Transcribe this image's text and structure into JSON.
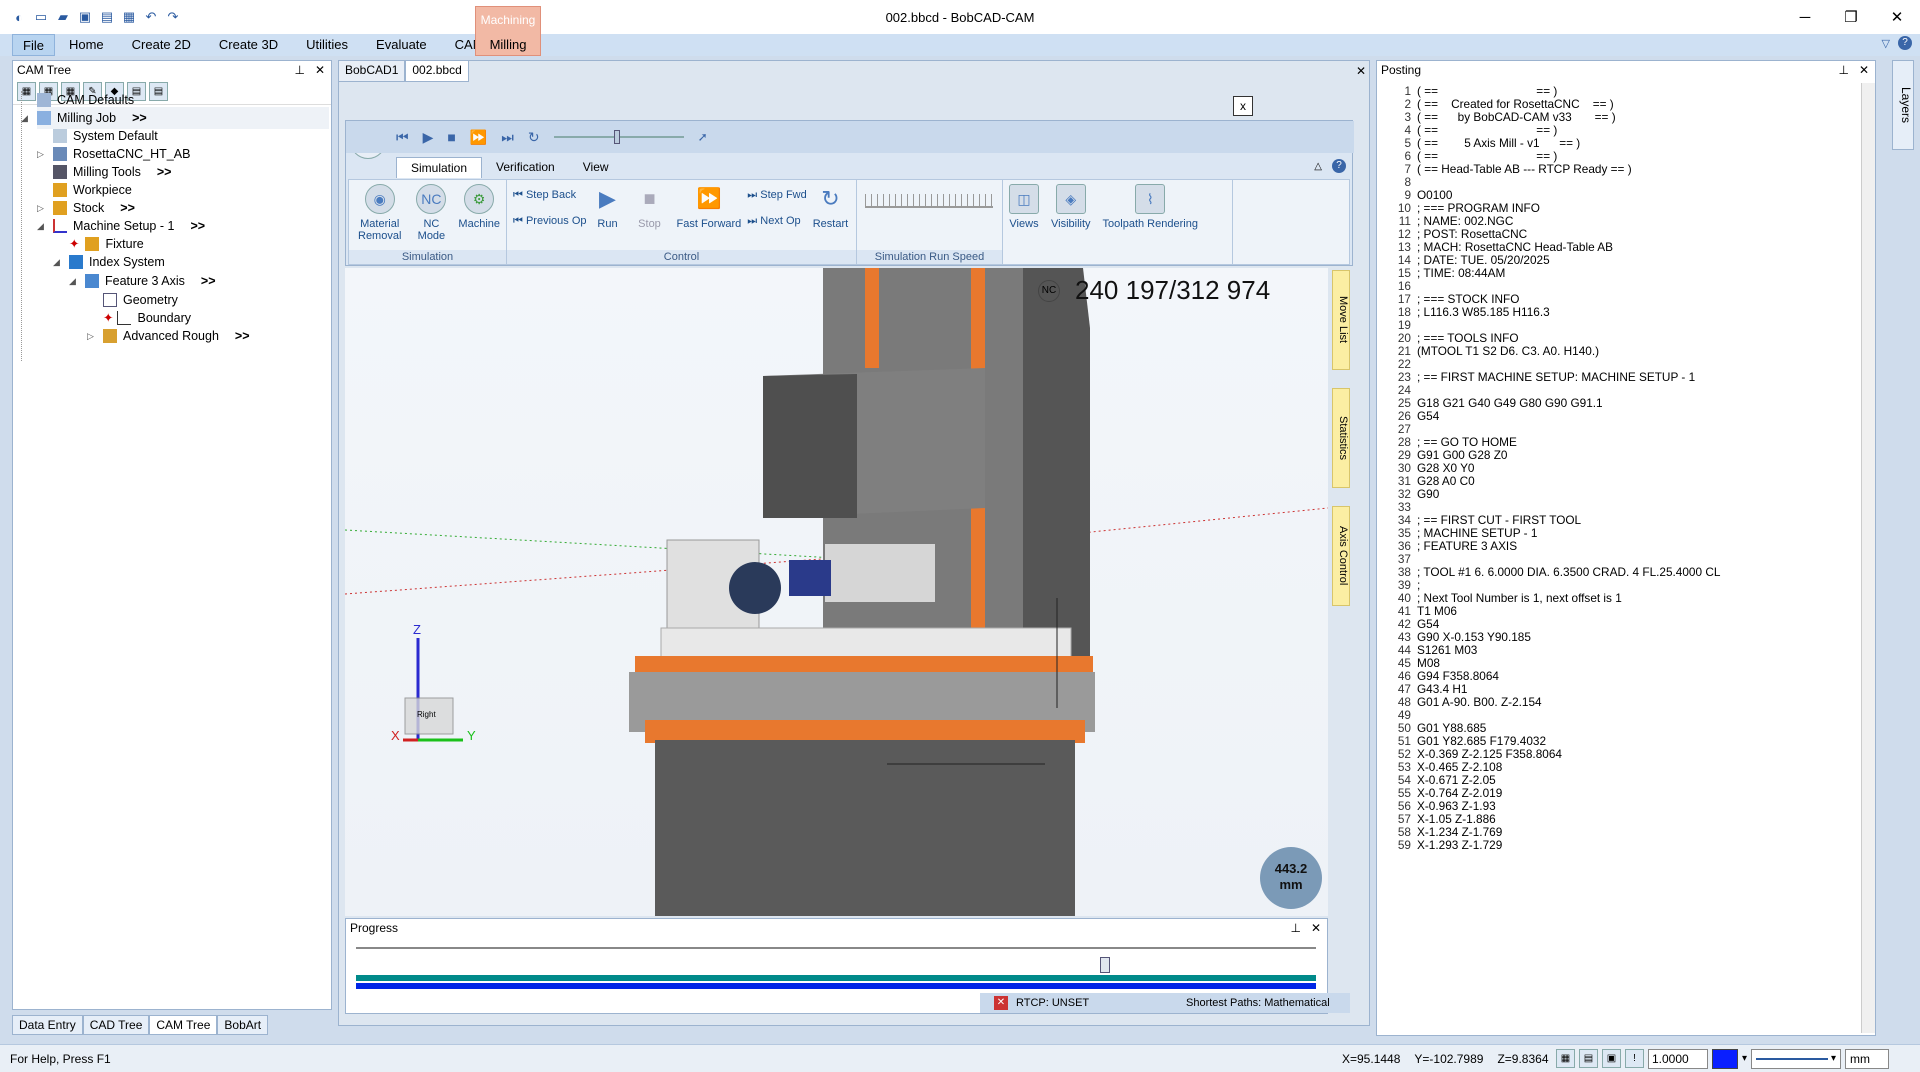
{
  "app": {
    "title": "002.bbcd - BobCAD-CAM"
  },
  "menu": {
    "file": "File",
    "items": [
      "Home",
      "Create 2D",
      "Create 3D",
      "Utilities",
      "Evaluate",
      "CAM"
    ],
    "context_group": "Machining",
    "context_tab": "Milling"
  },
  "cam_tree": {
    "title": "CAM Tree",
    "items": [
      {
        "label": "CAM Defaults",
        "arrow": ""
      },
      {
        "label": "Milling Job",
        "arrow": ">>"
      },
      {
        "label": "System Default",
        "arrow": ""
      },
      {
        "label": "RosettaCNC_HT_AB",
        "arrow": ""
      },
      {
        "label": "Milling Tools",
        "arrow": ">>"
      },
      {
        "label": "Workpiece",
        "arrow": ""
      },
      {
        "label": "Stock",
        "arrow": ">>"
      },
      {
        "label": "Machine Setup - 1",
        "arrow": ">>"
      },
      {
        "label": "Fixture",
        "arrow": ""
      },
      {
        "label": "Index System",
        "arrow": ""
      },
      {
        "label": "Feature 3 Axis",
        "arrow": ">>"
      },
      {
        "label": "Geometry",
        "arrow": ""
      },
      {
        "label": "Boundary",
        "arrow": ""
      },
      {
        "label": "Advanced Rough",
        "arrow": ">>"
      }
    ]
  },
  "bottom_tabs": [
    "Data Entry",
    "CAD Tree",
    "CAM Tree",
    "BobArt"
  ],
  "doc_tabs": [
    "BobCAD1",
    "002.bbcd"
  ],
  "sim": {
    "close": "x",
    "tabs": [
      "Simulation",
      "Verification",
      "View"
    ],
    "groups": {
      "simulation": "Simulation",
      "control": "Control",
      "speed": "Simulation Run Speed"
    },
    "buttons": {
      "material_removal": "Material Removal",
      "nc_mode": "NC Mode",
      "machine": "Machine",
      "step_back": "Step Back",
      "previous_op": "Previous Op",
      "run": "Run",
      "stop": "Stop",
      "fast_forward": "Fast Forward",
      "step_fwd": "Step Fwd",
      "next_op": "Next Op",
      "restart": "Restart",
      "views": "Views",
      "visibility": "Visibility",
      "toolpath_rendering": "Toolpath Rendering"
    },
    "nc_icon": "NC"
  },
  "viewport": {
    "coord_text": "240 197/312 974",
    "nc_badge": "NC",
    "measure_value": "443.2",
    "measure_unit": "mm",
    "side_tabs": [
      "Move List",
      "Statistics",
      "Axis Control"
    ],
    "triad": {
      "z": "Z",
      "x": "X",
      "y": "Y",
      "cube": "Right"
    }
  },
  "progress": {
    "title": "Progress",
    "rtcp": "RTCP: UNSET",
    "paths": "Shortest Paths: Mathematical",
    "value": 0.78
  },
  "posting": {
    "title": "Posting",
    "lines": [
      "( ==                              == )",
      "( ==    Created for RosettaCNC    == )",
      "( ==      by BobCAD-CAM v33       == )",
      "( ==                              == )",
      "( ==        5 Axis Mill - v1      == )",
      "( ==                              == )",
      "( == Head-Table AB --- RTCP Ready == )",
      "",
      "O0100",
      "; === PROGRAM INFO",
      "; NAME: 002.NGC",
      "; POST: RosettaCNC",
      "; MACH: RosettaCNC Head-Table AB",
      "; DATE: TUE. 05/20/2025",
      "; TIME: 08:44AM",
      "",
      "; === STOCK INFO",
      "; L116.3 W85.185 H116.3",
      "",
      "; === TOOLS INFO",
      "(MTOOL T1 S2 D6. C3. A0. H140.)",
      "",
      "; == FIRST MACHINE SETUP: MACHINE SETUP - 1",
      "",
      "G18 G21 G40 G49 G80 G90 G91.1",
      "G54",
      "",
      "; == GO TO HOME",
      "G91 G00 G28 Z0",
      "G28 X0 Y0",
      "G28 A0 C0",
      "G90",
      "",
      "; == FIRST CUT - FIRST TOOL",
      "; MACHINE SETUP - 1",
      "; FEATURE 3 AXIS",
      "",
      "; TOOL #1 6. 6.0000 DIA. 6.3500 CRAD. 4 FL.25.4000 CL",
      ";",
      "; Next Tool Number is 1, next offset is 1",
      "T1 M06",
      "G54",
      "G90 X-0.153 Y90.185",
      "S1261 M03",
      "M08",
      "G94 F358.8064",
      "G43.4 H1",
      "G01 A-90. B00. Z-2.154",
      "",
      "G01 Y88.685",
      "G01 Y82.685 F179.4032",
      "X-0.369 Z-2.125 F358.8064",
      "X-0.465 Z-2.108",
      "X-0.671 Z-2.05",
      "X-0.764 Z-2.019",
      "X-0.963 Z-1.93",
      "X-1.05 Z-1.886",
      "X-1.234 Z-1.769",
      "X-1.293 Z-1.729"
    ]
  },
  "layers": "Layers",
  "status": {
    "help": "For Help, Press F1",
    "x": "X=95.1448",
    "y": "Y=-102.7989",
    "z": "Z=9.8364",
    "scale": "1.0000",
    "unit": "mm"
  },
  "colors": {
    "accent": "#2a5aa0",
    "context": "#f2b9a5",
    "machine_orange": "#e8782e",
    "progress_blue": "#0026e6",
    "progress_teal": "#008a8a"
  }
}
